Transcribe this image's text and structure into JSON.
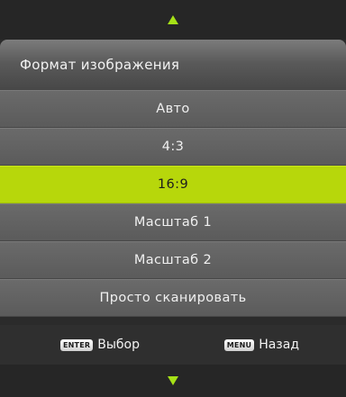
{
  "menu": {
    "title": "Формат изображения",
    "options": [
      {
        "label": "Авто"
      },
      {
        "label": "4:3"
      },
      {
        "label": "16:9"
      },
      {
        "label": "Масштаб 1"
      },
      {
        "label": "Масштаб 2"
      },
      {
        "label": "Просто сканировать"
      }
    ],
    "selected_index": 2
  },
  "footer": {
    "enter_key": "ENTER",
    "enter_label": "Выбор",
    "menu_key": "MENU",
    "menu_label": "Назад"
  },
  "icons": {
    "top": "arrow-up-icon",
    "bottom": "arrow-down-icon"
  },
  "colors": {
    "accent": "#b7d70b",
    "arrow": "#a6e117"
  }
}
